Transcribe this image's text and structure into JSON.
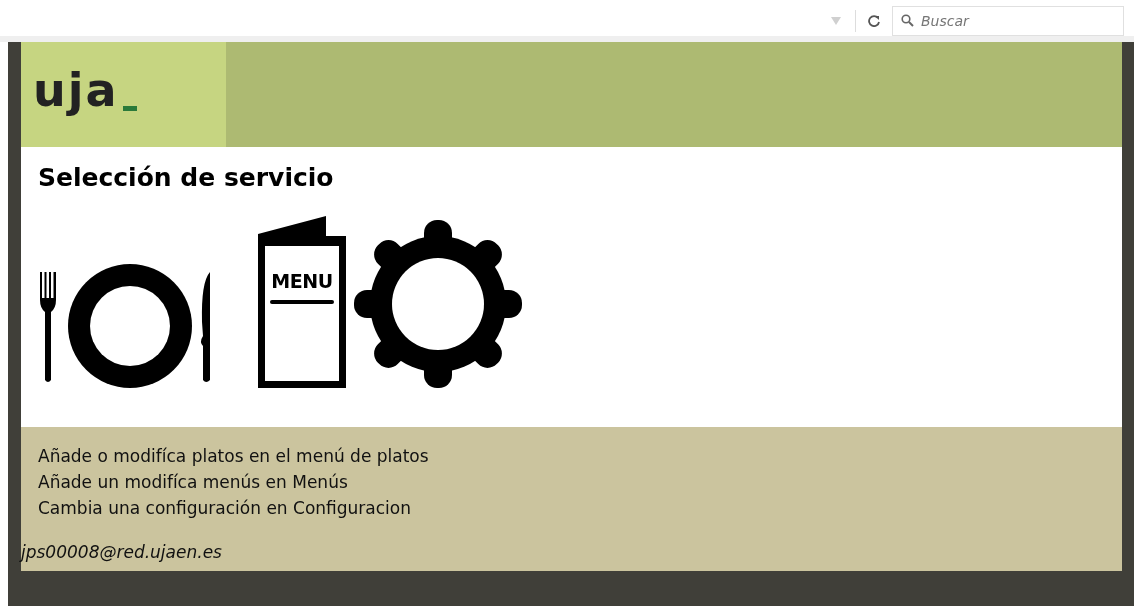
{
  "browser": {
    "search": {
      "placeholder": "Buscar"
    }
  },
  "header": {
    "logo": "uja"
  },
  "title": "Selección de servicio",
  "services": [
    {
      "kind": "dishes"
    },
    {
      "kind": "menu",
      "label": "MENU"
    },
    {
      "kind": "settings"
    }
  ],
  "help_lines": [
    "Añade o modifíca platos en el menú de platos",
    "Añade un modifíca menús en Menús",
    "Cambia una configuración en Configuracion"
  ],
  "user": "jps00008@red.ujaen.es"
}
